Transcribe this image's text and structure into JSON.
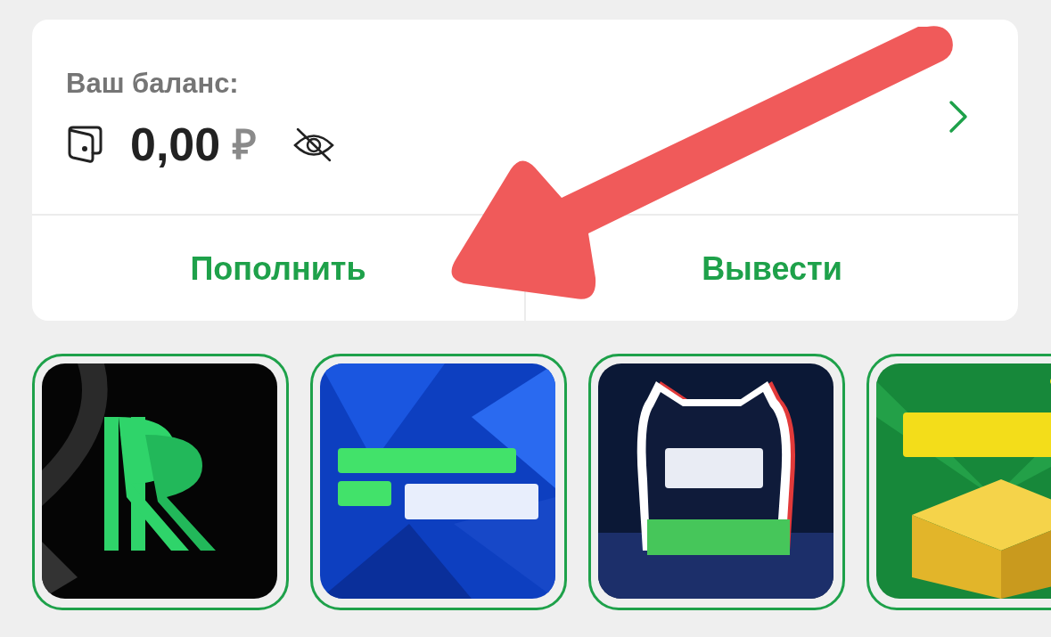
{
  "balance": {
    "label": "Ваш баланс:",
    "amount": "0,00",
    "currency": "₽"
  },
  "actions": [
    "Пополнить",
    "Вывести"
  ]
}
